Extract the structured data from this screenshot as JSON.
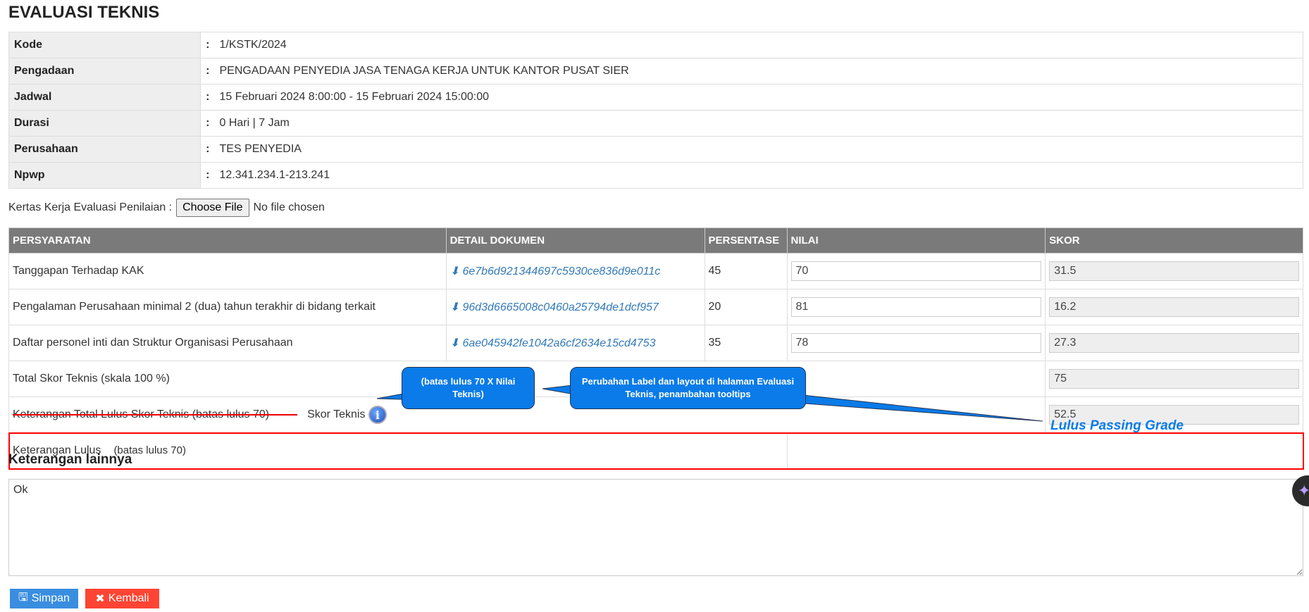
{
  "title": "EVALUASI TEKNIS",
  "info": [
    {
      "label": "Kode",
      "value": "1/KSTK/2024"
    },
    {
      "label": "Pengadaan",
      "value": "PENGADAAN PENYEDIA JASA TENAGA KERJA UNTUK KANTOR PUSAT SIER"
    },
    {
      "label": "Jadwal",
      "value": "15 Februari 2024 8:00:00 - 15 Februari 2024 15:00:00"
    },
    {
      "label": "Durasi",
      "value": "0 Hari | 7 Jam"
    },
    {
      "label": "Perusahaan",
      "value": "TES PENYEDIA"
    },
    {
      "label": "Npwp",
      "value": "12.341.234.1-213.241"
    }
  ],
  "colon": ":",
  "file": {
    "label": "Kertas Kerja Evaluasi Penilaian :",
    "button": "Choose File",
    "status": "No file chosen"
  },
  "table": {
    "headers": [
      "PERSYARATAN",
      "DETAIL DOKUMEN",
      "PERSENTASE",
      "NILAI",
      "SKOR"
    ],
    "rows": [
      {
        "req": "Tanggapan Terhadap KAK",
        "doc": "6e7b6d921344697c5930ce836d9e011c",
        "pct": "45",
        "nilai": "70",
        "skor": "31.5"
      },
      {
        "req": "Pengalaman Perusahaan minimal 2 (dua) tahun terakhir di bidang terkait",
        "doc": "96d3d6665008c0460a25794de1dcf957",
        "pct": "20",
        "nilai": "81",
        "skor": "16.2"
      },
      {
        "req": "Daftar personel inti dan Struktur Organisasi Perusahaan",
        "doc": "6ae045942fe1042a6cf2634e15cd4753",
        "pct": "35",
        "nilai": "78",
        "skor": "27.3"
      }
    ],
    "total_label": "Total Skor Teknis (skala 100 %)",
    "total_value": "75",
    "ket_old_label": "Keterangan Total Lulus Skor Teknis (batas lulus 70)",
    "ket_new_label": "Skor Teknis",
    "ket_value": "52.5",
    "lulus_label": "Keterangan Lulus",
    "lulus_note": "(batas lulus 70)",
    "lulus_result": "Lulus Passing Grade"
  },
  "callouts": {
    "one": "(batas lulus 70 X Nilai Teknis)",
    "two": "Perubahan Label dan layout di halaman Evaluasi Teknis, penambahan tooltips"
  },
  "other": {
    "heading": "Keterangan lainnya",
    "value": "Ok"
  },
  "buttons": {
    "save": "Simpan",
    "back": "Kembali"
  },
  "colors": {
    "accent": "#0a7be8",
    "save": "#3a8ee0",
    "back": "#ff4433",
    "highlight": "#ff0000"
  }
}
